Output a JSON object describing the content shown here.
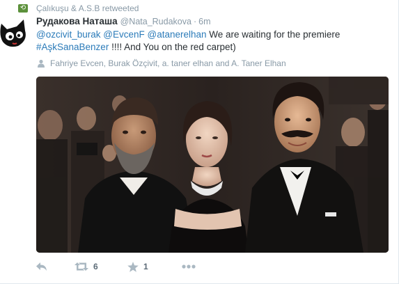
{
  "context": {
    "retweet_badge_glyph": "⟲",
    "text": "Çalıkuşu & A.S.B retweeted"
  },
  "header": {
    "fullname": "Рудакова Наташа",
    "username": "@Nata_Rudakova",
    "separator": "·",
    "time": "6m"
  },
  "tweet": {
    "segments": [
      {
        "type": "mention",
        "text": "@ozcivit_burak"
      },
      {
        "type": "plain",
        "text": " "
      },
      {
        "type": "mention",
        "text": "@EvcenF"
      },
      {
        "type": "plain",
        "text": " "
      },
      {
        "type": "mention",
        "text": "@atanerelhan"
      },
      {
        "type": "plain",
        "text": " We are waiting for the premiere "
      },
      {
        "type": "hashtag",
        "text": "#AşkSanaBenzer"
      },
      {
        "type": "plain",
        "text": " !!!! And You on the red carpet)"
      }
    ]
  },
  "tagged": {
    "icon": "person-icon",
    "text": "Fahriye Evcen, Burak Özçivit, a. taner elhan and A. Taner Elhan"
  },
  "actions": {
    "reply_icon": "reply-icon",
    "retweet_icon": "retweet-icon",
    "retweet_count": "6",
    "favorite_icon": "star-icon",
    "favorite_count": "1",
    "more_icon": "more-icon"
  },
  "colors": {
    "link": "#2b7bb9",
    "muted": "#8899a6",
    "retweet_badge": "#5c913b"
  }
}
